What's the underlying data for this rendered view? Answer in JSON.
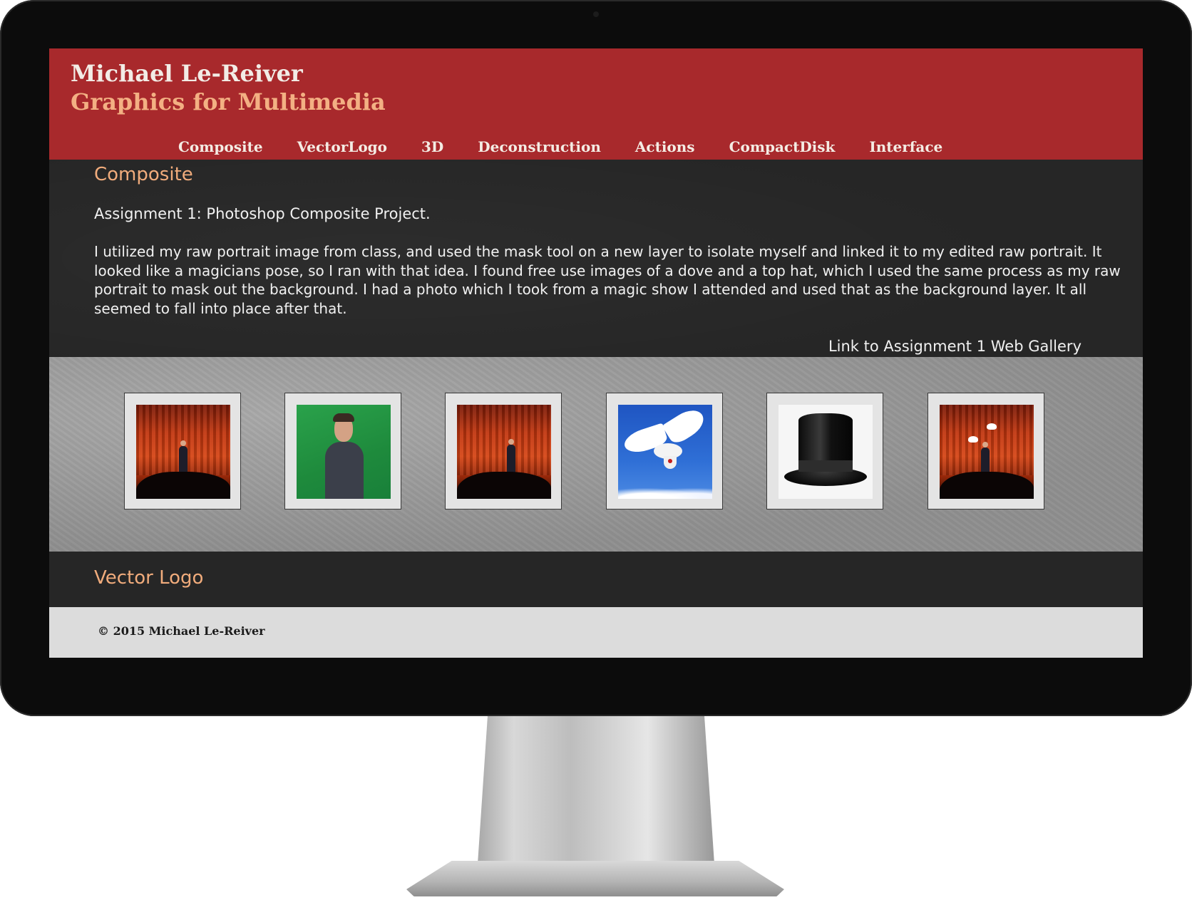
{
  "header": {
    "name": "Michael Le-Reiver",
    "subtitle": "Graphics for Multimedia"
  },
  "nav": {
    "items": [
      {
        "label": "Composite"
      },
      {
        "label": "VectorLogo"
      },
      {
        "label": "3D"
      },
      {
        "label": "Deconstruction"
      },
      {
        "label": "Actions"
      },
      {
        "label": "CompactDisk"
      },
      {
        "label": "Interface"
      }
    ]
  },
  "composite": {
    "heading": "Composite",
    "assignment_title": "Assignment 1: Photoshop Composite Project.",
    "body": "I utilized my raw portrait image from class, and used the mask tool on a new layer to isolate myself and linked it to my edited raw portrait. It looked like a magicians pose, so I ran with that idea. I found free use images of a dove and a top hat, which I used the same process as my raw portrait to mask out the background. I had a photo which I took from a magic show I attended and used that as the background layer. It all seemed to fall into place after that.",
    "gallery_link": "Link to Assignment 1 Web Gallery"
  },
  "gallery": {
    "thumbnails": [
      {
        "icon": "magic-show-stage-photo"
      },
      {
        "icon": "green-screen-portrait-photo"
      },
      {
        "icon": "magic-show-stage-photo"
      },
      {
        "icon": "dove-photo"
      },
      {
        "icon": "top-hat-photo"
      },
      {
        "icon": "final-composite-photo"
      }
    ]
  },
  "vector_logo": {
    "heading": "Vector Logo"
  },
  "footer": {
    "copyright": "© 2015 Michael Le-Reiver"
  },
  "colors": {
    "header_bg": "#a8292c",
    "accent": "#f1ac7c",
    "dark_bg": "#262626",
    "gallery_bg": "#9b9b9b",
    "footer_bg": "#dcdcdc"
  }
}
